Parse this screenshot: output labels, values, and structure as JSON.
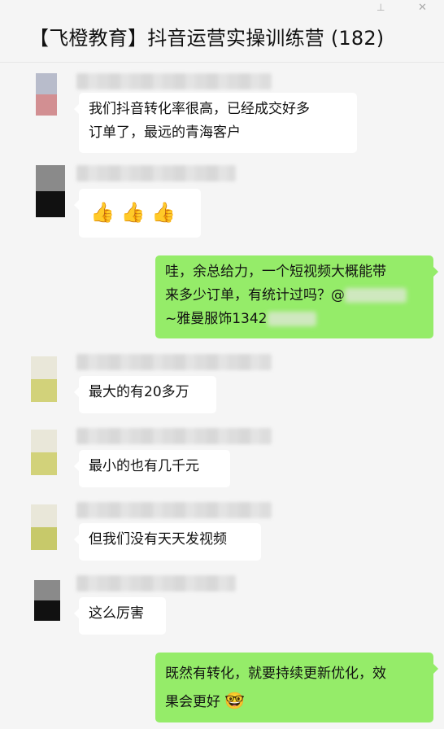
{
  "header": {
    "title": "【飞橙教育】抖音运营实操训练营 (182)",
    "pin_icon": "pin-icon",
    "close_icon": "close-icon"
  },
  "messages": [
    {
      "side": "left",
      "lines": [
        "我们抖音转化率很高，已经成交好多",
        "订单了，最远的青海客户"
      ]
    },
    {
      "side": "left",
      "emoji": "👍 👍 👍",
      "icon": "thumbs-up-icon"
    },
    {
      "side": "right",
      "lines": [
        "哇，余总给力，一个短视频大概能带",
        "来多少订单，有统计过吗？@",
        "~雅曼服饰1342"
      ]
    },
    {
      "side": "left",
      "lines": [
        "最大的有20多万"
      ]
    },
    {
      "side": "left",
      "lines": [
        "最小的也有几千元"
      ]
    },
    {
      "side": "left",
      "lines": [
        "但我们没有天天发视频"
      ]
    },
    {
      "side": "left",
      "lines": [
        "这么厉害"
      ]
    },
    {
      "side": "right",
      "lines": [
        "既然有转化，就要持续更新优化，效",
        "果会更好"
      ],
      "emoji": "🤓",
      "icon": "smug-face-icon"
    }
  ],
  "colors": {
    "background": "#f5f5f5",
    "bubble_left": "#ffffff",
    "bubble_right": "#95ec69"
  }
}
